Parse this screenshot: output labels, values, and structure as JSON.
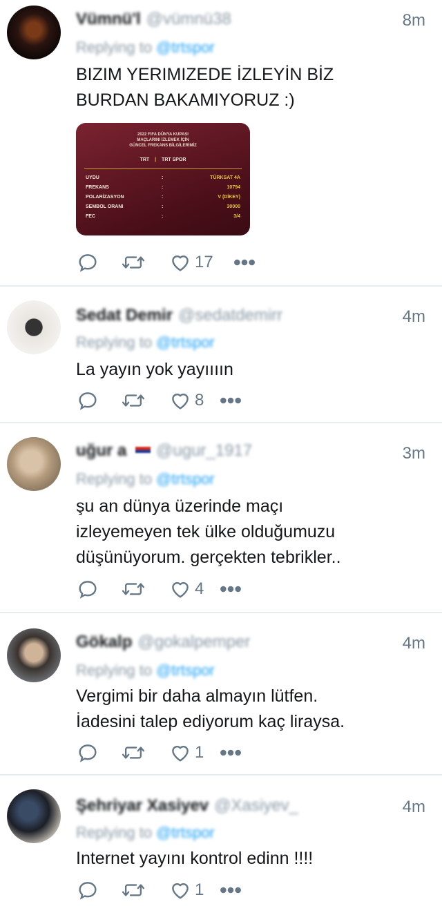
{
  "tweets": [
    {
      "name": "Vümnü'l",
      "handle": "@vümnü38",
      "time": "8m",
      "reply_prefix": "Replying to",
      "reply_to": "@trtspor",
      "text": "BIZIM YERIMIZEDE İZLEYİN BİZ\nBURDAN BAKAMIYORUZ :)",
      "likes": "17",
      "media": {
        "title_lines": [
          "2022 FIFA DÜNYA KUPASI",
          "MAÇLARINI İZLEMEK İÇİN",
          "GÜNCEL FREKANS BİLGİLERİMİZ"
        ],
        "brand_left": "TRT",
        "brand_right": "TRT SPOR",
        "rows": [
          {
            "key": "UYDU",
            "value": "TÜRKSAT 4A"
          },
          {
            "key": "FREKANS",
            "value": "10794"
          },
          {
            "key": "POLARİZASYON",
            "value": "V (DİKEY)"
          },
          {
            "key": "SEMBOL ORANI",
            "value": "30000"
          },
          {
            "key": "FEC",
            "value": "3/4"
          }
        ]
      }
    },
    {
      "name": "Sedat Demir",
      "handle": "@sedatdemirr",
      "time": "4m",
      "reply_prefix": "Replying to",
      "reply_to": "@trtspor",
      "text": "La yayın yok yayıııın",
      "likes": "8"
    },
    {
      "name": "uğur a",
      "handle": "@ugur_1917",
      "time": "3m",
      "reply_prefix": "Replying to",
      "reply_to": "@trtspor",
      "text": "şu an dünya üzerinde maçı\nizleyemeyen tek ülke olduğumuzu\ndüşünüyorum. gerçekten tebrikler..",
      "likes": "4"
    },
    {
      "name": "Gökalp",
      "handle": "@gokalpemper",
      "time": "4m",
      "reply_prefix": "Replying to",
      "reply_to": "@trtspor",
      "text": "Vergimi bir daha almayın lütfen.\nİadesini talep ediyorum kaç liraysa.",
      "likes": "1"
    },
    {
      "name": "Şehriyar Xasiyev",
      "handle": "@Xasiyev_",
      "time": "4m",
      "reply_prefix": "Replying to",
      "reply_to": "@trtspor",
      "text": "Internet yayını kontrol edinn !!!!",
      "likes": "1"
    }
  ],
  "icons": {
    "reply": "reply-icon",
    "retweet": "retweet-icon",
    "like": "heart-icon",
    "more": "more-icon"
  },
  "colors": {
    "mention": "#1da1f2",
    "muted": "#657786",
    "divider": "#e6ecf0"
  }
}
